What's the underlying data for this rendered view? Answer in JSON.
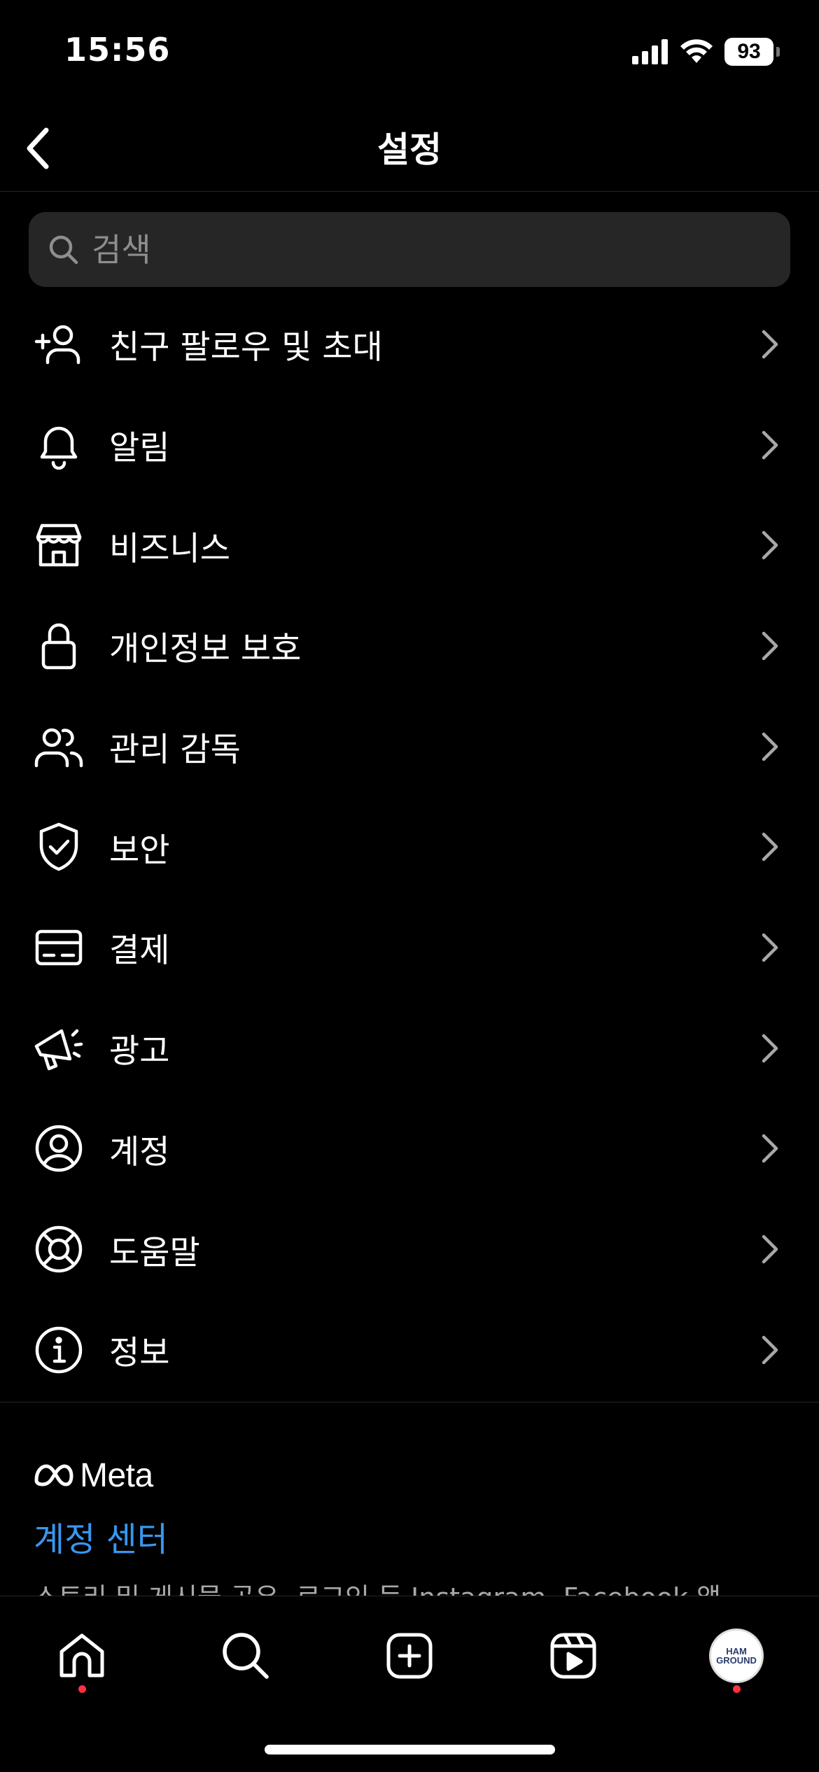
{
  "status_bar": {
    "time": "15:56",
    "battery": "93"
  },
  "header": {
    "title": "설정"
  },
  "search": {
    "placeholder": "검색"
  },
  "menu": {
    "items": [
      {
        "label": "친구 팔로우 및 초대",
        "icon": "add-person-icon"
      },
      {
        "label": "알림",
        "icon": "bell-icon"
      },
      {
        "label": "비즈니스",
        "icon": "shop-icon"
      },
      {
        "label": "개인정보 보호",
        "icon": "lock-icon"
      },
      {
        "label": "관리 감독",
        "icon": "people-icon"
      },
      {
        "label": "보안",
        "icon": "shield-check-icon"
      },
      {
        "label": "결제",
        "icon": "credit-card-icon"
      },
      {
        "label": "광고",
        "icon": "megaphone-icon"
      },
      {
        "label": "계정",
        "icon": "user-circle-icon"
      },
      {
        "label": "도움말",
        "icon": "lifebuoy-icon"
      },
      {
        "label": "정보",
        "icon": "info-icon"
      }
    ]
  },
  "meta_section": {
    "brand": "Meta",
    "accounts_center": "계정 센터",
    "description": "스토리 및 게시물 공유, 로그인 등 Instagram, Facebook 앱"
  },
  "tab_bar": {
    "tabs": [
      {
        "name": "home",
        "icon": "home-icon",
        "has_dot": true
      },
      {
        "name": "search",
        "icon": "search-icon",
        "has_dot": false
      },
      {
        "name": "create",
        "icon": "plus-square-icon",
        "has_dot": false
      },
      {
        "name": "reels",
        "icon": "reels-icon",
        "has_dot": false
      },
      {
        "name": "profile",
        "icon": "avatar",
        "has_dot": true
      }
    ],
    "avatar_text": [
      "HAM",
      "GROUND"
    ]
  },
  "colors": {
    "background": "#000000",
    "accent": "#3797f0",
    "notification_dot": "#ff3040",
    "search_bg": "#262626"
  }
}
